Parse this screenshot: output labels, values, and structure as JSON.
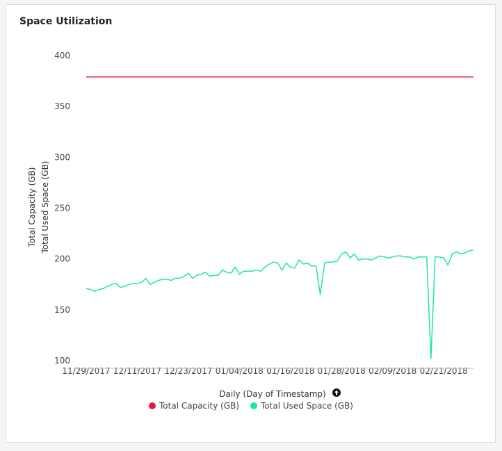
{
  "panel": {
    "title": "Space Utilization"
  },
  "colors": {
    "capacity": "#e8173f",
    "used": "#19e8a0"
  },
  "chart_data": {
    "type": "line",
    "ylabel": [
      "Total Capacity (GB)",
      "Total Used Space (GB)"
    ],
    "xlabel": "Daily (Day of Timestamp)",
    "sort_icon": "up-arrow-circle-icon",
    "ylim": [
      100,
      400
    ],
    "yticks": [
      100,
      150,
      200,
      250,
      300,
      350,
      400
    ],
    "xlim": [
      "2017-11-29",
      "2018-02-28"
    ],
    "xticks": [
      "11/29/2017",
      "12/11/2017",
      "12/23/2017",
      "01/04/2018",
      "01/16/2018",
      "01/28/2018",
      "02/09/2018",
      "02/21/2018"
    ],
    "xtick_dates": [
      "2017-11-29",
      "2017-12-11",
      "2017-12-23",
      "2018-01-04",
      "2018-01-16",
      "2018-01-28",
      "2018-02-09",
      "2018-02-21"
    ],
    "legend_position": "bottom-center",
    "grid": false,
    "series": [
      {
        "name": "Total Capacity (GB)",
        "x": [
          "2017-11-29",
          "2018-02-28"
        ],
        "values": [
          379,
          379
        ]
      },
      {
        "name": "Total Used Space (GB)",
        "x": [
          "2017-11-29",
          "2017-11-30",
          "2017-12-01",
          "2017-12-02",
          "2017-12-03",
          "2017-12-04",
          "2017-12-05",
          "2017-12-06",
          "2017-12-07",
          "2017-12-08",
          "2017-12-09",
          "2017-12-10",
          "2017-12-11",
          "2017-12-12",
          "2017-12-13",
          "2017-12-14",
          "2017-12-15",
          "2017-12-16",
          "2017-12-17",
          "2017-12-18",
          "2017-12-19",
          "2017-12-20",
          "2017-12-21",
          "2017-12-22",
          "2017-12-23",
          "2017-12-24",
          "2017-12-25",
          "2017-12-26",
          "2017-12-27",
          "2017-12-28",
          "2017-12-29",
          "2017-12-30",
          "2017-12-31",
          "2018-01-01",
          "2018-01-02",
          "2018-01-03",
          "2018-01-04",
          "2018-01-05",
          "2018-01-06",
          "2018-01-07",
          "2018-01-08",
          "2018-01-09",
          "2018-01-10",
          "2018-01-11",
          "2018-01-12",
          "2018-01-13",
          "2018-01-14",
          "2018-01-15",
          "2018-01-16",
          "2018-01-17",
          "2018-01-18",
          "2018-01-19",
          "2018-01-20",
          "2018-01-21",
          "2018-01-22",
          "2018-01-23",
          "2018-01-24",
          "2018-01-25",
          "2018-01-26",
          "2018-01-27",
          "2018-01-28",
          "2018-01-29",
          "2018-01-30",
          "2018-01-31",
          "2018-02-01",
          "2018-02-02",
          "2018-02-03",
          "2018-02-04",
          "2018-02-05",
          "2018-02-06",
          "2018-02-07",
          "2018-02-08",
          "2018-02-09",
          "2018-02-10",
          "2018-02-11",
          "2018-02-12",
          "2018-02-13",
          "2018-02-14",
          "2018-02-15",
          "2018-02-16",
          "2018-02-17",
          "2018-02-18",
          "2018-02-19",
          "2018-02-20",
          "2018-02-21",
          "2018-02-22",
          "2018-02-23",
          "2018-02-24",
          "2018-02-25",
          "2018-02-26",
          "2018-02-27",
          "2018-02-28"
        ],
        "values": [
          171,
          170,
          168,
          170,
          171,
          173,
          175,
          176,
          172,
          173,
          175,
          176,
          176,
          177,
          181,
          175,
          177,
          179,
          180,
          180,
          179,
          181,
          181,
          183,
          186,
          181,
          184,
          185,
          187,
          183,
          184,
          184,
          189,
          187,
          186,
          192,
          185,
          188,
          188,
          188,
          189,
          188,
          192,
          195,
          197,
          196,
          189,
          196,
          192,
          191,
          199,
          195,
          196,
          193,
          193,
          165,
          196,
          197,
          197,
          198,
          205,
          207,
          201,
          205,
          199,
          200,
          200,
          199,
          201,
          203,
          202,
          201,
          202,
          203,
          203,
          202,
          202,
          200,
          202,
          202,
          202,
          102,
          202,
          202,
          201,
          194,
          205,
          207,
          205,
          206,
          208,
          209
        ]
      }
    ]
  }
}
